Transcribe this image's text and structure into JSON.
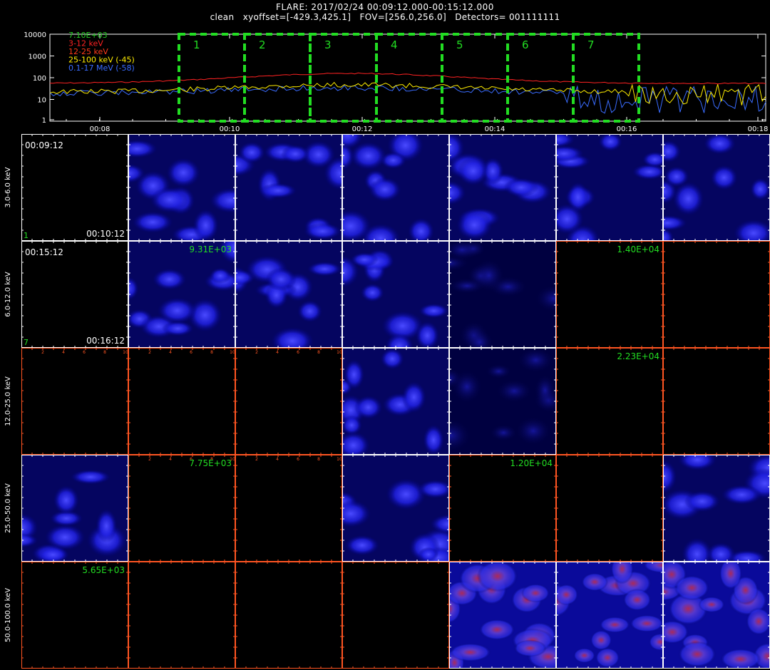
{
  "header": {
    "title": "FLARE: 2017/02/24 00:09:12.000-00:15:12.000",
    "subtitle": "clean   xyoffset=[-429.3,425.1]   FOV=[256.0,256.0]   Detectors= 001111111"
  },
  "lightcurve": {
    "y_ticks": [
      "10000",
      "1000",
      "100",
      "10",
      "1"
    ],
    "x_ticks": [
      "00:08",
      "00:10",
      "00:12",
      "00:14",
      "00:16",
      "00:18"
    ],
    "legend": [
      {
        "label": "7.10E+03",
        "color": "#22cc22"
      },
      {
        "label": "3-12 keV",
        "color": "#ff2222"
      },
      {
        "label": "12-25 keV",
        "color": "#ff3a1a"
      },
      {
        "label": "25-100 keV (-45)",
        "color": "#ffee00"
      },
      {
        "label": "0.1-17 MeV (-58)",
        "color": "#3a6cff"
      }
    ],
    "box_labels": [
      "1",
      "2",
      "3",
      "4",
      "5",
      "6",
      "7"
    ],
    "box_color": "#22dd22"
  },
  "grid": {
    "row_labels": [
      "3.0-6.0  keV",
      "6.0-12.0  keV",
      "12.0-25.0  keV",
      "25.0-50.0  keV",
      "50.0-100.0  keV"
    ],
    "cells": [
      [
        "text",
        "blue",
        "blue",
        "blue",
        "blue",
        "blue",
        "blue"
      ],
      [
        "text",
        "blue",
        "blue",
        "blue",
        "faint",
        "black",
        "black"
      ],
      [
        "black",
        "black",
        "black",
        "blue",
        "faint",
        "black",
        "black"
      ],
      [
        "blue",
        "black",
        "black",
        "blue",
        "black",
        "black",
        "blue"
      ],
      [
        "black",
        "black",
        "black",
        "black",
        "hot",
        "hot",
        "hot"
      ]
    ],
    "info": [
      {
        "row": 0,
        "start": "00:09:12",
        "end": "00:10:12",
        "index": "1"
      },
      {
        "row": 1,
        "start": "00:15:12",
        "end": "00:16:12",
        "index": "7"
      }
    ],
    "peaks": [
      {
        "row": 1,
        "col": 1,
        "text": "9.31E+03"
      },
      {
        "row": 1,
        "col": 5,
        "text": "1.40E+04"
      },
      {
        "row": 2,
        "col": 5,
        "text": "2.23E+04"
      },
      {
        "row": 3,
        "col": 1,
        "text": "7.75E+03"
      },
      {
        "row": 3,
        "col": 4,
        "text": "1.20E+04"
      },
      {
        "row": 4,
        "col": 0,
        "text": "5.65E+03"
      }
    ],
    "axis_ticks": [
      "2",
      "4",
      "6",
      "8",
      "10"
    ]
  },
  "colors": {
    "frame": "#ff5522",
    "text": "#ffffff",
    "peak_text": "#22dd22",
    "red_curve": "#ff2222",
    "yellow_curve": "#ffee00",
    "blue_curve": "#3a6cff"
  }
}
